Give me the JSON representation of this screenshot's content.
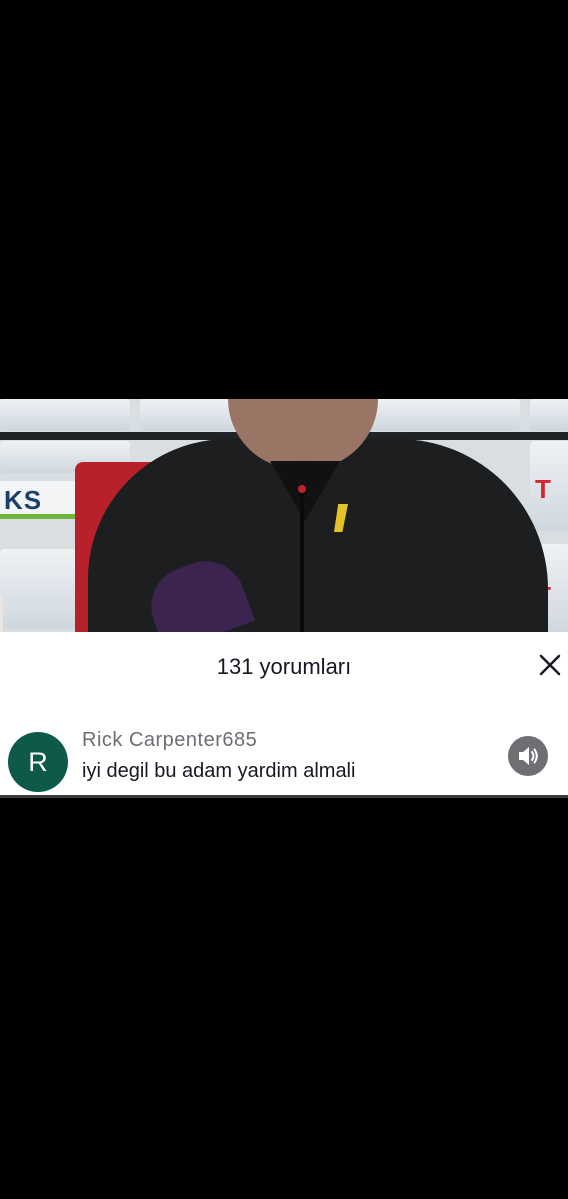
{
  "video": {
    "sponsor_left": "KS",
    "sponsor_right_1": "T",
    "sponsor_right_2": "T"
  },
  "comments_panel": {
    "title": "131 yorumları",
    "close_icon": "close-icon"
  },
  "comment": {
    "avatar_letter": "R",
    "avatar_color": "#0e5a4a",
    "username": "Rick Carpenter685",
    "text": "iyi degil bu adam yardim almali",
    "speaker_icon": "speaker-icon"
  }
}
